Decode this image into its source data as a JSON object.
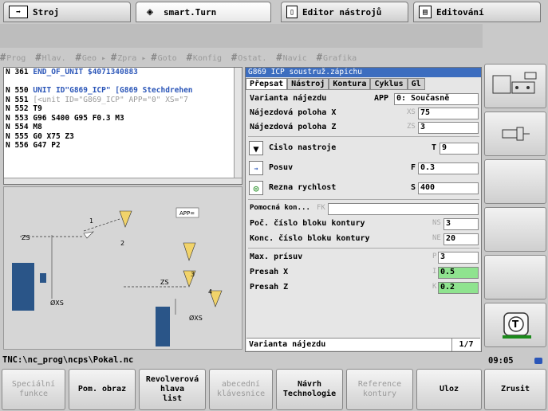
{
  "modes": [
    {
      "label": "Stroj",
      "icon": "arrow-right-icon"
    },
    {
      "label": "smart.Turn",
      "icon": "diamond-arrow-icon"
    },
    {
      "label": "Editor nástrojů",
      "icon": "tool-editor-icon"
    },
    {
      "label": "Editování",
      "icon": "edit-icon"
    }
  ],
  "menu": [
    "Prog",
    "Hlav.",
    "Geo",
    "Zpra",
    "Goto",
    "Konfig",
    "Ostat.",
    "Navic",
    "Grafika"
  ],
  "program": {
    "lines": [
      {
        "n": "N 361",
        "t": "END_OF_UNIT $4071340883"
      },
      {
        "n": "",
        "t": ""
      },
      {
        "n": "N 550",
        "t": "UNIT ID\"G869_ICP\" [G869 Stechdrehen"
      },
      {
        "n": "N 551",
        "t": "[<unit ID=\"G869_ICP\" APP=\"0\" XS=\"7"
      },
      {
        "n": "N 552",
        "t": "T9"
      },
      {
        "n": "N 553",
        "t": "G96 S400 G95 F0.3 M3"
      },
      {
        "n": "N 554",
        "t": "M8"
      },
      {
        "n": "N 555",
        "t": "G0 X75 Z3"
      },
      {
        "n": "N 556",
        "t": "G47 P2"
      }
    ]
  },
  "graphic": {
    "labels": {
      "zs1": "ZS",
      "xs1": "ØXS",
      "zs2": "ZS",
      "xs2": "ØXS",
      "n1": "1",
      "n2": "2",
      "n3": "3",
      "n4": "4",
      "app": "APP="
    }
  },
  "form": {
    "title": "G869 ICP soustruž.zápichu",
    "tabs": [
      "Přepsat",
      "Nástroj",
      "Kontura",
      "Cyklus",
      "Gl"
    ],
    "rows": [
      {
        "label": "Varianta nájezdu",
        "addr": "APP",
        "value": "0: Současně"
      },
      {
        "label": "Nájezdová poloha X",
        "addr": "XS",
        "value": "75"
      },
      {
        "label": "Nájezdová poloha Z",
        "addr": "ZS",
        "value": "3"
      },
      {
        "label": "Cislo nastroje",
        "addr": "T",
        "value": "9"
      },
      {
        "label": "Posuv",
        "addr": "F",
        "value": "0.3"
      },
      {
        "label": "Rezna rychlost",
        "addr": "S",
        "value": "400"
      },
      {
        "label": "Pomocná kon...",
        "addr": "FK",
        "value": ""
      },
      {
        "label": "Poč. číslo bloku kontury",
        "addr": "NS",
        "value": "3"
      },
      {
        "label": "Konc. číslo bloku kontury",
        "addr": "NE",
        "value": "20"
      },
      {
        "label": "Max. prísuv",
        "addr": "P",
        "value": "3"
      },
      {
        "label": "Presah X",
        "addr": "I",
        "value": "0.5"
      },
      {
        "label": "Presah Z",
        "addr": "K",
        "value": "0.2"
      }
    ],
    "status_text": "Varianta nájezdu",
    "page": "1/7"
  },
  "status": {
    "path": "TNC:\\nc_prog\\ncps\\Pokal.nc",
    "time": "09:05"
  },
  "softkeys": [
    "Speciální\nfunkce",
    "Pom. obraz",
    "Revolverová\nhlava\nlist",
    "abecední\nklávesnice",
    "Návrh\nTechnologie",
    "Reference\nkontury",
    "Uloz",
    "Zrusit"
  ],
  "colors": {
    "title_bar": "#3c6dbf",
    "highlight": "#8fe38f",
    "program_keyword": "#2b56b8",
    "program_comment": "#1b8a1b"
  }
}
